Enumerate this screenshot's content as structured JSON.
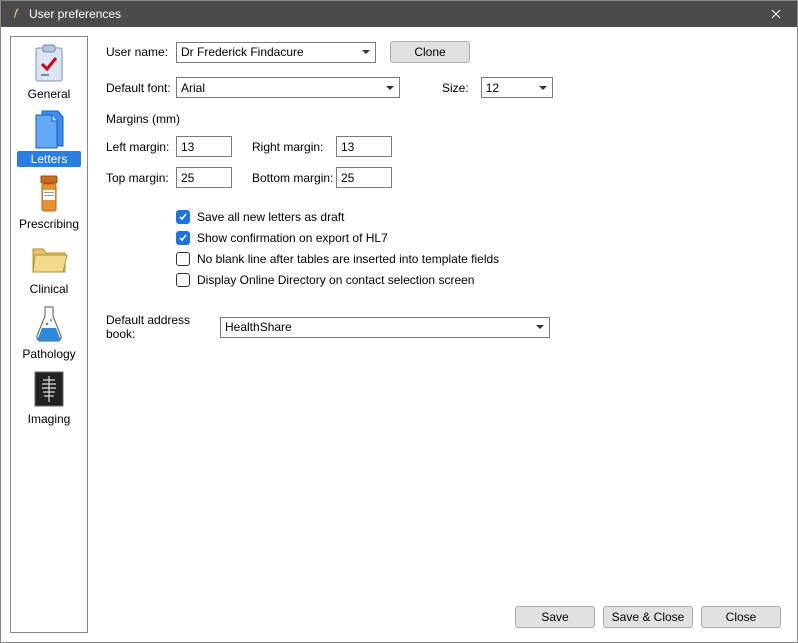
{
  "titlebar": {
    "title": "User preferences"
  },
  "sidebar": {
    "items": [
      {
        "label": "General"
      },
      {
        "label": "Letters"
      },
      {
        "label": "Prescribing"
      },
      {
        "label": "Clinical"
      },
      {
        "label": "Pathology"
      },
      {
        "label": "Imaging"
      }
    ],
    "selected": "Letters"
  },
  "user": {
    "label": "User name:",
    "value": "Dr Frederick Findacure",
    "clone_label": "Clone"
  },
  "font": {
    "label": "Default font:",
    "value": "Arial",
    "size_label": "Size:",
    "size_value": "12"
  },
  "margins": {
    "group_label": "Margins (mm)",
    "left_label": "Left margin:",
    "left_value": "13",
    "right_label": "Right margin:",
    "right_value": "13",
    "top_label": "Top margin:",
    "top_value": "25",
    "bottom_label": "Bottom margin:",
    "bottom_value": "25"
  },
  "checks": {
    "draft": {
      "label": "Save all new letters as draft",
      "checked": true
    },
    "hl7": {
      "label": "Show confirmation on export of HL7",
      "checked": true
    },
    "blank": {
      "label": "No blank line after tables are inserted into template fields",
      "checked": false
    },
    "directory": {
      "label": "Display Online Directory on contact selection screen",
      "checked": false
    }
  },
  "address_book": {
    "label": "Default address book:",
    "value": "HealthShare"
  },
  "footer": {
    "save": "Save",
    "save_close": "Save & Close",
    "close": "Close"
  }
}
